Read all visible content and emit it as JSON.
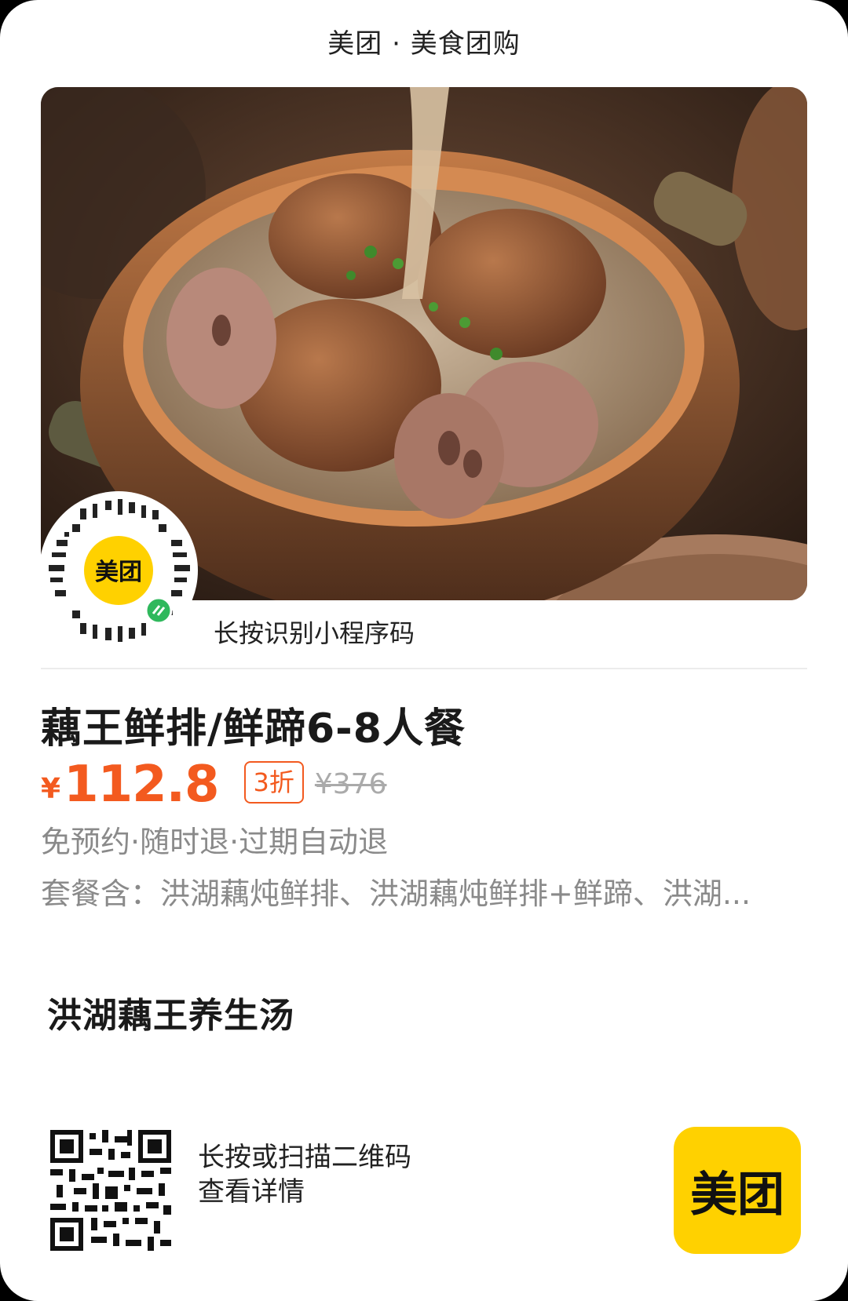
{
  "header": {
    "title": "美团 · 美食团购"
  },
  "mini_program": {
    "logo_text": "美团",
    "caption": "长按识别小程序码"
  },
  "deal": {
    "title": "藕王鲜排/鲜蹄6-8人餐",
    "currency": "¥",
    "price": "112.8",
    "discount": "3折",
    "original_price": "¥376",
    "policy": "免预约·随时退·过期自动退",
    "package": "套餐含：洪湖藕炖鲜排、洪湖藕炖鲜排+鲜蹄、洪湖..."
  },
  "shop": {
    "name": "洪湖藕王养生汤"
  },
  "footer": {
    "scan_line1": "长按或扫描二维码",
    "scan_line2": "查看详情",
    "logo_text": "美团"
  },
  "colors": {
    "accent": "#f35a1f",
    "brand": "#ffd100"
  }
}
